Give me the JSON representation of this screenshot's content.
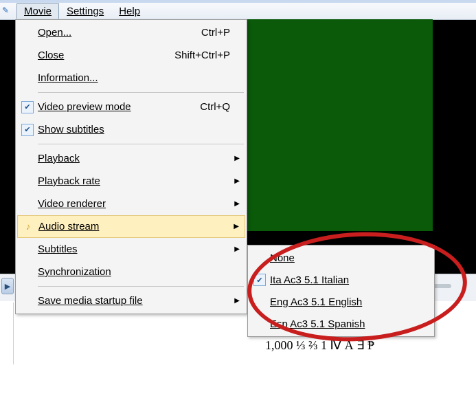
{
  "menubar": {
    "movie": "Movie",
    "settings": "Settings",
    "help": "Help"
  },
  "menu": {
    "open": {
      "label": "Open...",
      "shortcut": "Ctrl+P"
    },
    "close": {
      "label": "Close",
      "shortcut": "Shift+Ctrl+P"
    },
    "information": {
      "label": "Information..."
    },
    "video_preview": {
      "label": "Video preview mode",
      "shortcut": "Ctrl+Q"
    },
    "show_subtitles": {
      "label": "Show subtitles"
    },
    "playback": {
      "label": "Playback"
    },
    "playback_rate": {
      "label": "Playback rate"
    },
    "video_renderer": {
      "label": "Video renderer"
    },
    "audio_stream": {
      "label": "Audio stream"
    },
    "subtitles": {
      "label": "Subtitles"
    },
    "synchronization": {
      "label": "Synchronization"
    },
    "save_startup": {
      "label": "Save media startup file"
    }
  },
  "submenu": {
    "none": "None",
    "ita": "Ita Ac3 5.1 Italian",
    "eng": "Eng Ac3 5.1 English",
    "esp": "Esp Ac3 5.1 Spanish"
  },
  "sample_text": "1,000  ⅓ ⅔ 1 Ⅳ Å ∃ ₱"
}
